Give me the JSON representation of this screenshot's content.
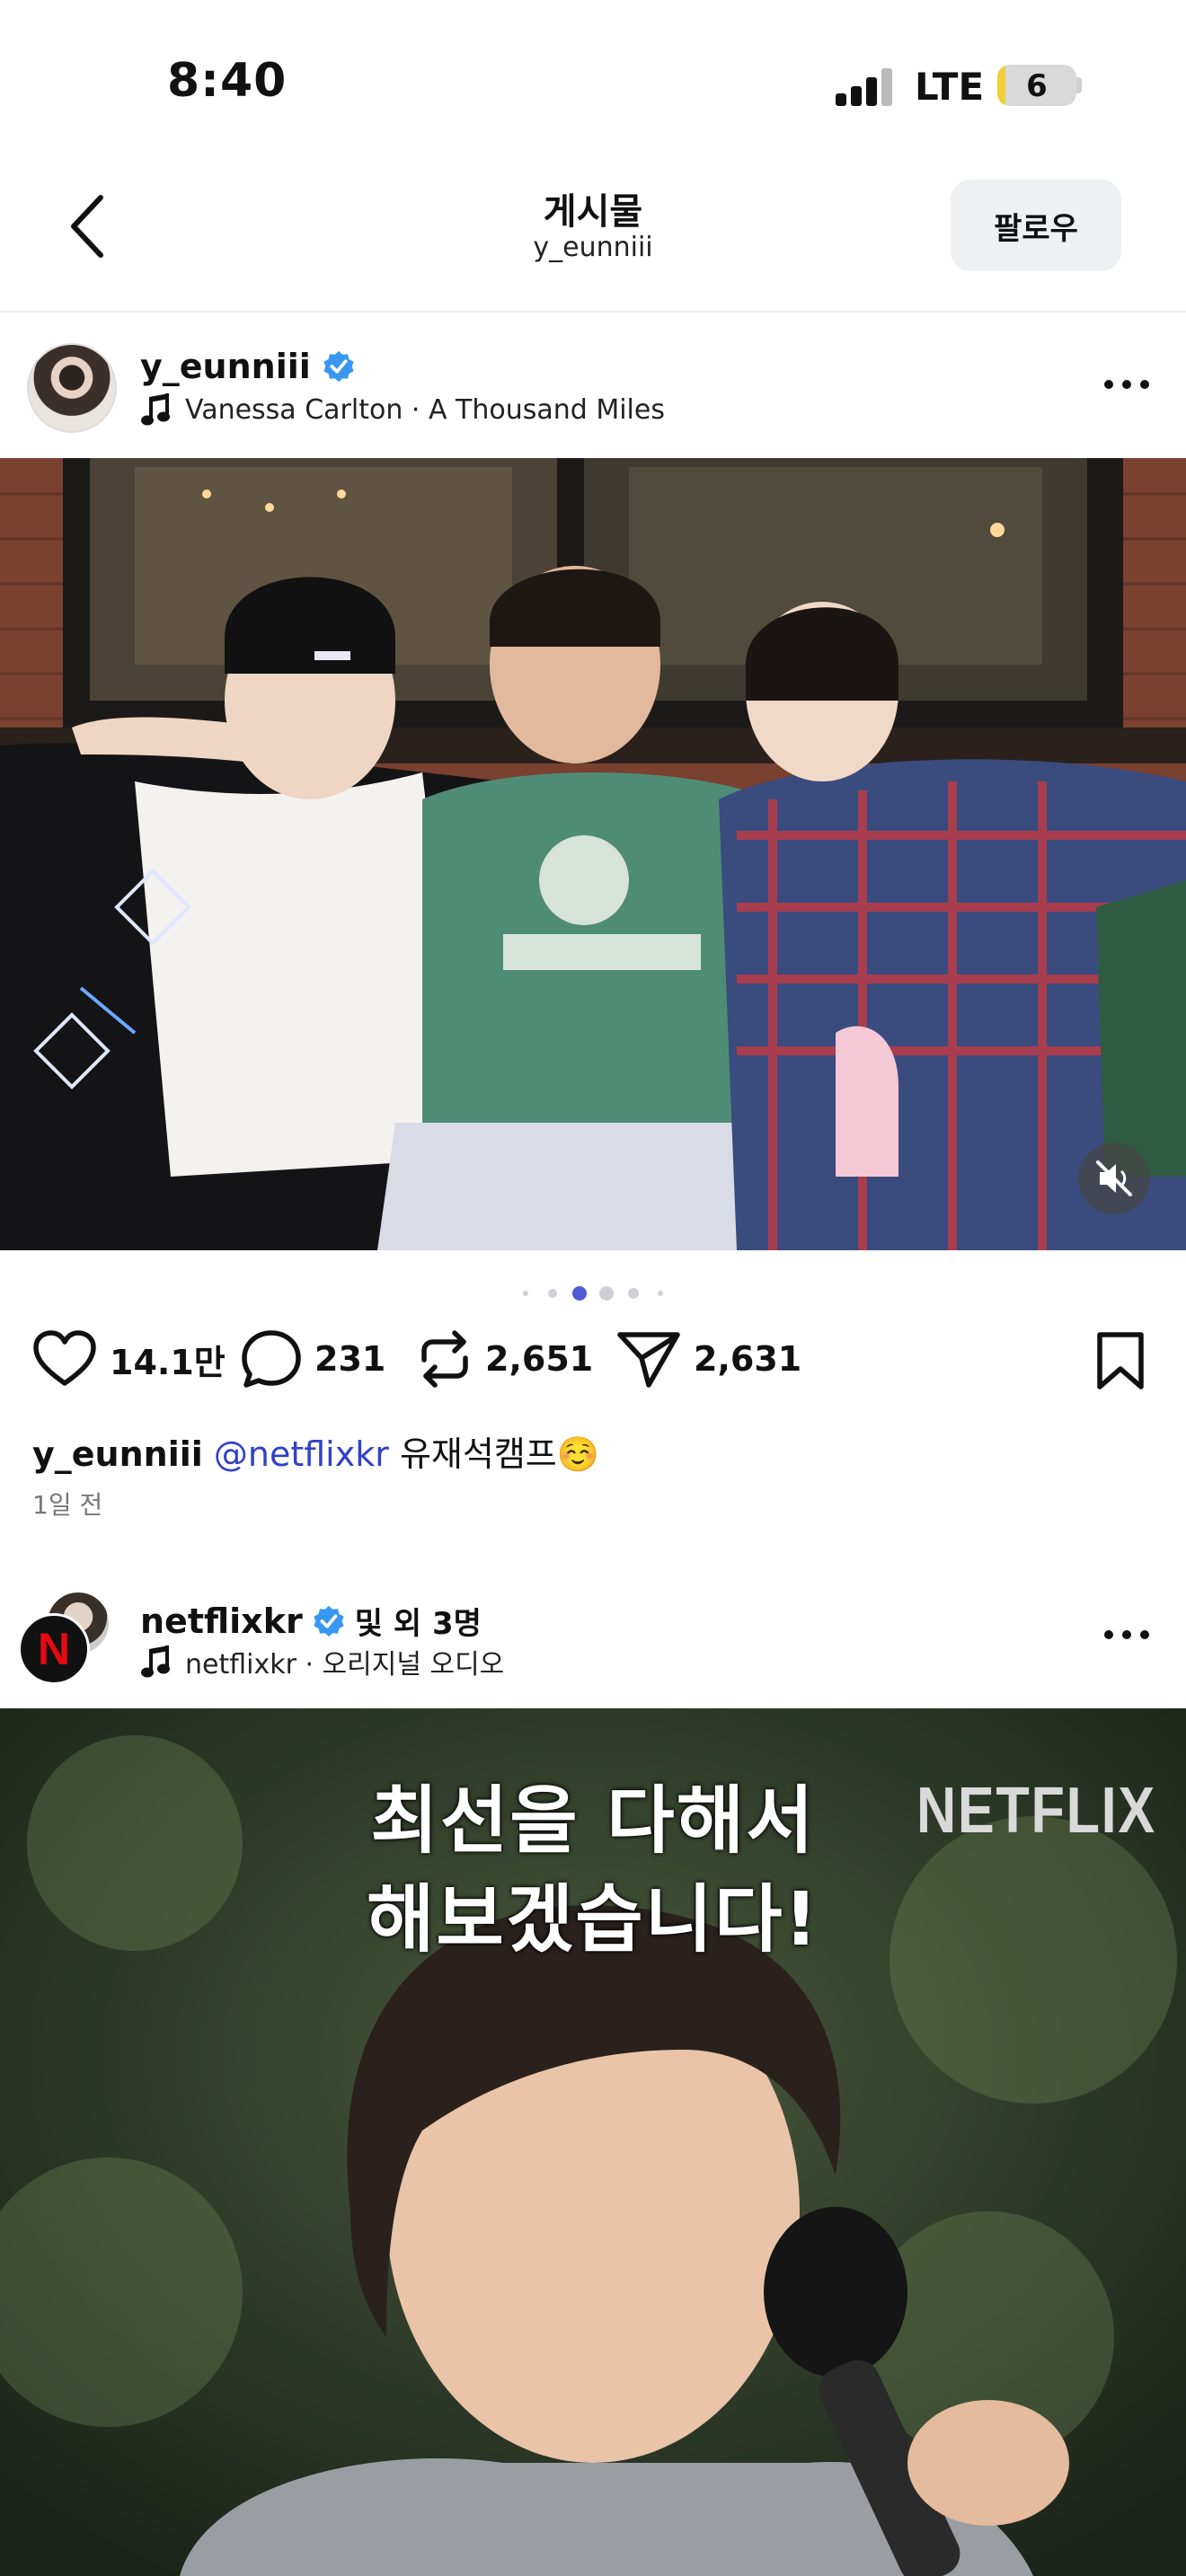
{
  "status_bar": {
    "time": "8:40",
    "network": "LTE",
    "battery_level": "6",
    "battery_fraction": 0.06
  },
  "header": {
    "title": "게시물",
    "subtitle": "y_eunniii",
    "follow_label": "팔로우"
  },
  "post1": {
    "username": "y_eunniii",
    "music": "Vanessa Carlton · A Thousand Miles",
    "carousel": {
      "count": 6,
      "active_index": 2
    },
    "likes": "14.1만",
    "comments": "231",
    "reposts": "2,651",
    "shares": "2,631",
    "caption_user": "y_eunniii",
    "caption_mention": "@netflixkr",
    "caption_text": " 유재석캠프☺️",
    "time_ago": "1일 전"
  },
  "post2": {
    "username": "netflixkr",
    "collab": "및 외 3명",
    "music": "netflixkr · 오리지널 오디오",
    "subtitle_line1": "최선을 다해서",
    "subtitle_line2": "해보겠습니다!",
    "watermark": "NETFLIX",
    "avatar_letter": "N"
  },
  "colors": {
    "verified": "#3897f0",
    "mention": "#3240c8",
    "carousel_active": "#4f5bd5"
  }
}
